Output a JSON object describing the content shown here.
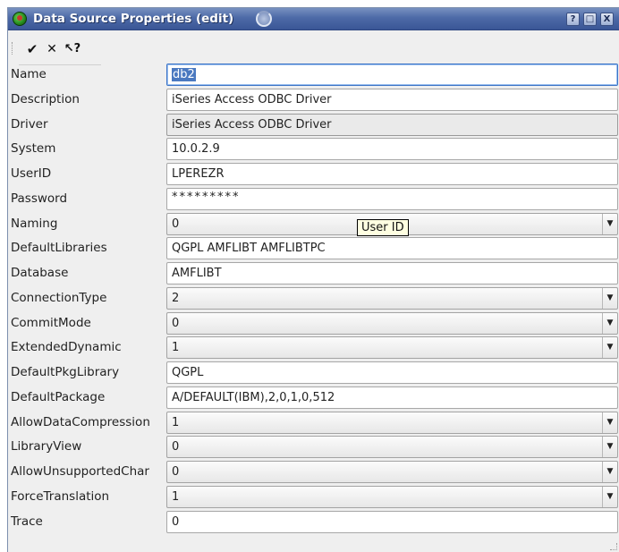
{
  "window": {
    "title": "Data Source Properties (edit)",
    "buttons": {
      "help": "?",
      "maximize": "□",
      "close": "X"
    }
  },
  "toolbar": {
    "apply_icon": "✔",
    "cancel_icon": "✕",
    "whats_this_icon": "↖?"
  },
  "fields": [
    {
      "label": "Name",
      "value": "db2",
      "type": "text"
    },
    {
      "label": "Description",
      "value": "iSeries Access ODBC Driver",
      "type": "text"
    },
    {
      "label": "Driver",
      "value": "iSeries Access ODBC Driver",
      "type": "readonly"
    },
    {
      "label": "System",
      "value": "10.0.2.9",
      "type": "text"
    },
    {
      "label": "UserID",
      "value": "LPEREZR",
      "type": "text"
    },
    {
      "label": "Password",
      "value": "*********",
      "type": "password"
    },
    {
      "label": "Naming",
      "value": "0",
      "type": "select"
    },
    {
      "label": "DefaultLibraries",
      "value": "QGPL AMFLIBT AMFLIBTPC",
      "type": "text"
    },
    {
      "label": "Database",
      "value": "AMFLIBT",
      "type": "text"
    },
    {
      "label": "ConnectionType",
      "value": "2",
      "type": "select"
    },
    {
      "label": "CommitMode",
      "value": "0",
      "type": "select"
    },
    {
      "label": "ExtendedDynamic",
      "value": "1",
      "type": "select"
    },
    {
      "label": "DefaultPkgLibrary",
      "value": "QGPL",
      "type": "text"
    },
    {
      "label": "DefaultPackage",
      "value": "A/DEFAULT(IBM),2,0,1,0,512",
      "type": "text"
    },
    {
      "label": "AllowDataCompression",
      "value": "1",
      "type": "select"
    },
    {
      "label": "LibraryView",
      "value": "0",
      "type": "select"
    },
    {
      "label": "AllowUnsupportedChar",
      "value": "0",
      "type": "select"
    },
    {
      "label": "ForceTranslation",
      "value": "1",
      "type": "select"
    },
    {
      "label": "Trace",
      "value": "0",
      "type": "text"
    }
  ],
  "tooltip": "User ID",
  "colors": {
    "titlebar": "#4d6aa7",
    "selection": "#4b79c0",
    "tooltip_bg": "#ffffe1"
  }
}
